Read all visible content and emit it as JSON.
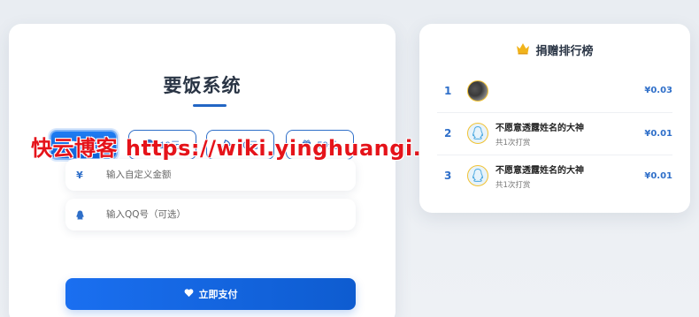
{
  "title": "要饭系统",
  "amounts": [
    {
      "label": "5元",
      "icon": "coffee-icon",
      "active": true
    },
    {
      "label": "10元",
      "icon": "burger-icon",
      "active": false
    },
    {
      "label": "20元",
      "icon": "pizza-icon",
      "active": false
    },
    {
      "label": "50元",
      "icon": "gift-icon",
      "active": false
    }
  ],
  "custom_amount": {
    "symbol": "¥",
    "placeholder": "输入自定义金额"
  },
  "qq": {
    "placeholder": "输入QQ号（可选）",
    "icon": "qq-penguin-icon"
  },
  "pay_button": {
    "label": "立即支付",
    "icon": "heart-icon"
  },
  "watermark": "快云博客  https://wiki.yinghuangi.cn/",
  "leaderboard": {
    "title": "捐赠排行榜",
    "icon": "crown-icon",
    "entries": [
      {
        "rank": "1",
        "name": "",
        "sub": "",
        "amount": "¥0.03",
        "avatar": "photo"
      },
      {
        "rank": "2",
        "name": "不愿意透露姓名的大神",
        "sub": "共1次打赏",
        "amount": "¥0.01",
        "avatar": "qq-default"
      },
      {
        "rank": "3",
        "name": "不愿意透露姓名的大神",
        "sub": "共1次打赏",
        "amount": "¥0.01",
        "avatar": "qq-default"
      }
    ]
  },
  "colors": {
    "accent": "#1a6ff0",
    "title": "#2a3545",
    "watermark": "#e5131a",
    "crown": "#f1b41c"
  }
}
